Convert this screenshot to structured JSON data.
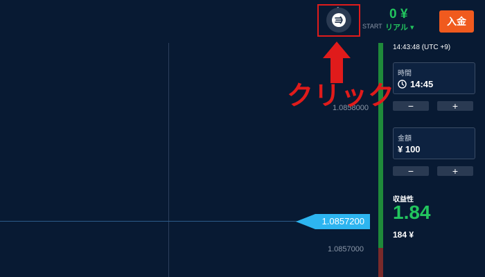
{
  "chart": {
    "price_label_upper": "1.0858000",
    "price_label_lower": "1.0857000",
    "current_price": "1.0857200"
  },
  "header": {
    "avatar_badge": "●",
    "balance": "0 ¥",
    "start_label": "START",
    "account_type": "リアル ▾",
    "deposit_label": "入金"
  },
  "annotation": {
    "click_text": "クリック"
  },
  "panel": {
    "server_time": "14:43:48 (UTC +9)",
    "time": {
      "label": "時間",
      "value": "14:45"
    },
    "amount": {
      "label": "金額",
      "value": "¥ 100"
    },
    "minus_label": "−",
    "plus_label": "+",
    "yield_label": "収益性",
    "yield_value": "1.84",
    "payout": "184 ¥"
  },
  "colors": {
    "background": "#081a33",
    "balance_green": "#22c55e",
    "deposit_orange": "#f05a1e",
    "price_tag_blue": "#2db5f0",
    "highlight_red": "#e01b1b"
  },
  "icons": {
    "avatar": "profile-avatar-icon",
    "clock": "clock-icon",
    "arrow": "up-arrow-icon"
  }
}
